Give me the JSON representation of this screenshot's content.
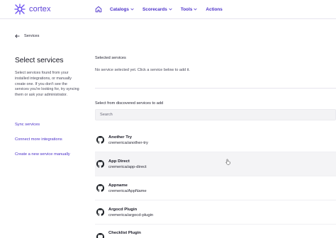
{
  "app": {
    "name": "cortex",
    "brand_color": "#5b3fd6",
    "link_color": "#4b30c9"
  },
  "nav": {
    "home_icon": "home-icon",
    "items": [
      {
        "label": "Catalogs",
        "has_dropdown": true
      },
      {
        "label": "Scorecards",
        "has_dropdown": true
      },
      {
        "label": "Tools",
        "has_dropdown": true
      },
      {
        "label": "Actions",
        "has_dropdown": false
      }
    ]
  },
  "breadcrumb": {
    "back_label": "Services"
  },
  "sidebar": {
    "title": "Select services",
    "description": "Select services found from your installed integrations, or manually create one. If you don't see the services you're looking for, try syncing them or ask your administrator.",
    "links": [
      {
        "label": "Sync services"
      },
      {
        "label": "Connect more integrations"
      },
      {
        "label": "Create a new service manually"
      }
    ]
  },
  "selected": {
    "label": "Selected services",
    "empty_text": "No service selected yet. Click a service below to add it."
  },
  "discovered": {
    "label": "Select from discovered services to add",
    "search_placeholder": "Search",
    "services": [
      {
        "name": "Another Try",
        "tag": "cremerica/another-try",
        "icon": "github-icon"
      },
      {
        "name": "App Direct",
        "tag": "cremerica/app-direct",
        "icon": "github-icon"
      },
      {
        "name": "Appname",
        "tag": "cremerica/AppName",
        "icon": "github-icon"
      },
      {
        "name": "Argocd Plugin",
        "tag": "cremerica/argocd-plugin",
        "icon": "github-icon"
      },
      {
        "name": "Checklist Plugin",
        "tag": "",
        "icon": "github-icon"
      }
    ]
  }
}
